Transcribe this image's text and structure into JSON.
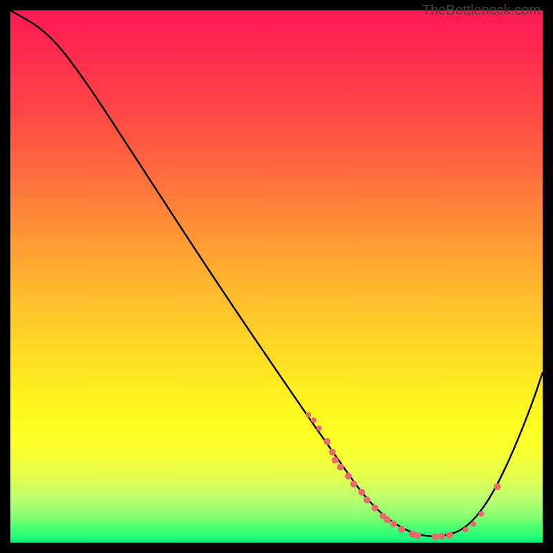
{
  "watermark": "TheBottleneck.com",
  "chart_data": {
    "type": "line",
    "title": "",
    "xlabel": "",
    "ylabel": "",
    "xlim": [
      0,
      100
    ],
    "ylim": [
      0,
      100
    ],
    "curve": [
      {
        "x": 0,
        "y": 100
      },
      {
        "x": 7,
        "y": 96
      },
      {
        "x": 14,
        "y": 87
      },
      {
        "x": 25,
        "y": 70
      },
      {
        "x": 40,
        "y": 47
      },
      {
        "x": 55,
        "y": 25
      },
      {
        "x": 62,
        "y": 15
      },
      {
        "x": 67,
        "y": 8
      },
      {
        "x": 72,
        "y": 3.5
      },
      {
        "x": 77,
        "y": 1.2
      },
      {
        "x": 82,
        "y": 1.2
      },
      {
        "x": 86,
        "y": 3
      },
      {
        "x": 90,
        "y": 8
      },
      {
        "x": 94,
        "y": 16
      },
      {
        "x": 98,
        "y": 26
      },
      {
        "x": 100,
        "y": 32
      }
    ],
    "markers": [
      {
        "x": 56,
        "y": 24,
        "size": 4
      },
      {
        "x": 57,
        "y": 23,
        "size": 4
      },
      {
        "x": 58,
        "y": 21.5,
        "size": 4
      },
      {
        "x": 59.5,
        "y": 19,
        "size": 5
      },
      {
        "x": 60.5,
        "y": 17,
        "size": 5
      },
      {
        "x": 61,
        "y": 15.5,
        "size": 5
      },
      {
        "x": 62,
        "y": 14.2,
        "size": 5
      },
      {
        "x": 63.5,
        "y": 12.5,
        "size": 5
      },
      {
        "x": 64.5,
        "y": 11,
        "size": 5
      },
      {
        "x": 66,
        "y": 9.5,
        "size": 5
      },
      {
        "x": 67,
        "y": 8,
        "size": 5
      },
      {
        "x": 68.5,
        "y": 6.5,
        "size": 5
      },
      {
        "x": 70,
        "y": 5,
        "size": 5
      },
      {
        "x": 70.8,
        "y": 4.3,
        "size": 5
      },
      {
        "x": 72,
        "y": 3.5,
        "size": 5
      },
      {
        "x": 73.5,
        "y": 2.5,
        "size": 5
      },
      {
        "x": 75.5,
        "y": 1.6,
        "size": 5
      },
      {
        "x": 76.5,
        "y": 1.3,
        "size": 5
      },
      {
        "x": 79.8,
        "y": 1.1,
        "size": 5
      },
      {
        "x": 81,
        "y": 1.2,
        "size": 5
      },
      {
        "x": 82.5,
        "y": 1.4,
        "size": 5
      },
      {
        "x": 85.5,
        "y": 2.4,
        "size": 4
      },
      {
        "x": 87,
        "y": 3.5,
        "size": 4
      },
      {
        "x": 88.5,
        "y": 5.4,
        "size": 4
      },
      {
        "x": 91.5,
        "y": 10.5,
        "size": 5
      }
    ],
    "marker_color": "#e96a6a"
  }
}
